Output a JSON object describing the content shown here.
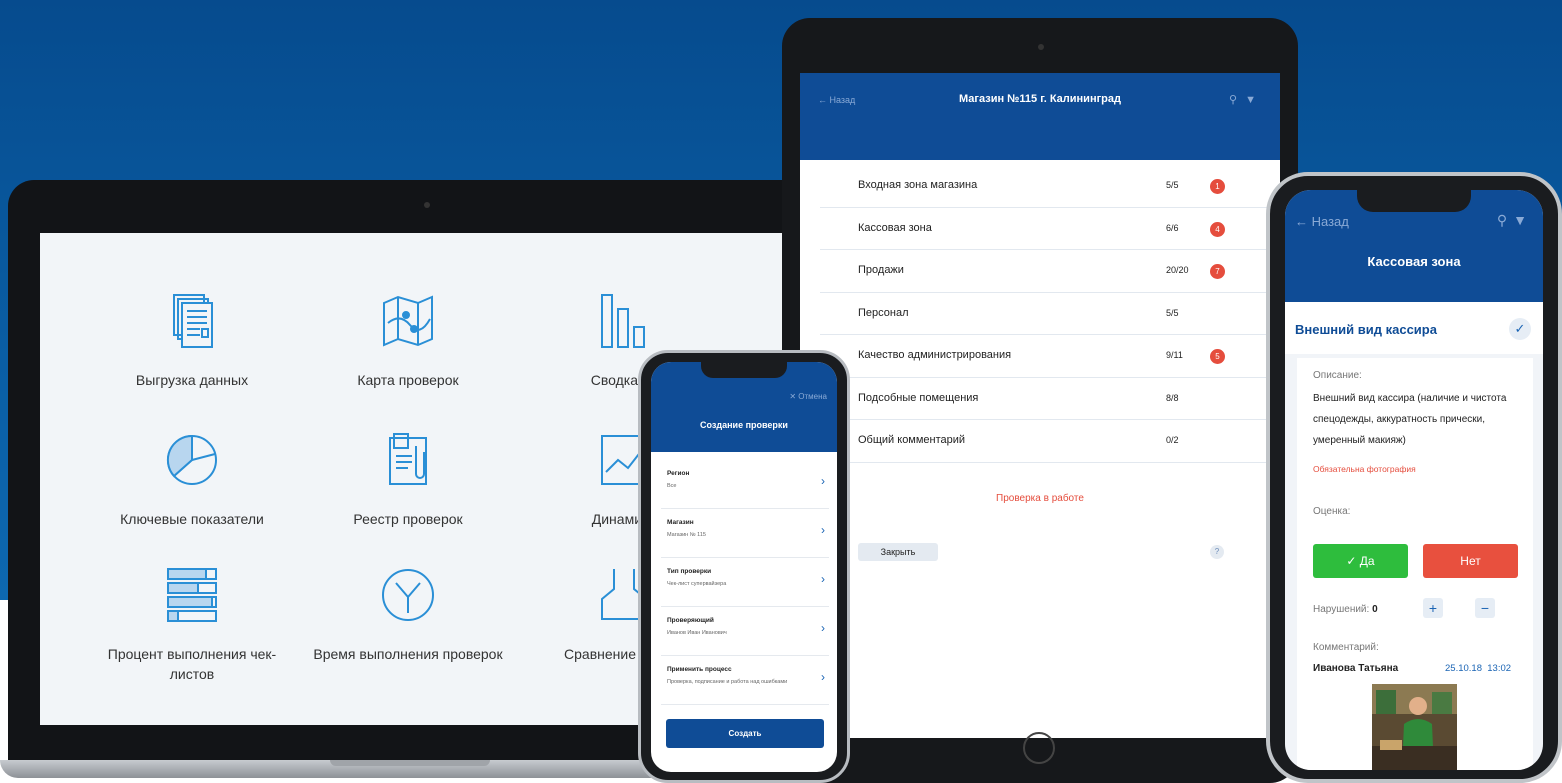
{
  "laptop": {
    "tiles": [
      {
        "label": "Выгрузка данных",
        "icon": "documents-icon"
      },
      {
        "label": "Карта проверок",
        "icon": "map-icon"
      },
      {
        "label": "Сводка по",
        "icon": "bar-chart-icon"
      },
      {
        "label": "Ключевые показатели",
        "icon": "pie-chart-icon"
      },
      {
        "label": "Реестр проверок",
        "icon": "clipboard-icon"
      },
      {
        "label": "Динамика",
        "icon": "trend-icon"
      },
      {
        "label": "Процент выполнения чек-листов",
        "icon": "progress-bars-icon"
      },
      {
        "label": "Время выполнения проверок",
        "icon": "clock-icon"
      },
      {
        "label": "Сравнение эффек",
        "icon": "compare-icon"
      }
    ]
  },
  "tablet": {
    "back": "← Назад",
    "title": "Магазин №115 г. Калининград",
    "rows": [
      {
        "name": "Входная зона магазина",
        "count": "5/5",
        "badge": "1"
      },
      {
        "name": "Кассовая зона",
        "count": "6/6",
        "badge": "4"
      },
      {
        "name": "Продажи",
        "count": "20/20",
        "badge": "7"
      },
      {
        "name": "Персонал",
        "count": "5/5",
        "badge": ""
      },
      {
        "name": "Качество администрирования",
        "count": "9/11",
        "badge": "5"
      },
      {
        "name": "Подсобные помещения",
        "count": "8/8",
        "badge": ""
      },
      {
        "name": "Общий комментарий",
        "count": "0/2",
        "badge": ""
      }
    ],
    "status": "Проверка в работе",
    "close": "Закрыть",
    "help": "?"
  },
  "phone1": {
    "cancel": "✕ Отмена",
    "title": "Создание проверки",
    "rows": [
      {
        "key": "Регион",
        "value": "Все"
      },
      {
        "key": "Магазин",
        "value": "Магазин № 115"
      },
      {
        "key": "Тип проверки",
        "value": "Чек-лист супервайзера"
      },
      {
        "key": "Проверяющий",
        "value": "Иванов Иван Иванович"
      },
      {
        "key": "Применить процесс",
        "value": "Проверка, подписание и работа над ошибками"
      }
    ],
    "create": "Создать"
  },
  "phone2": {
    "back": "← Назад",
    "title": "Кассовая зона",
    "section": "Внешний вид кассира",
    "desc_label": "Описание:",
    "desc": "Внешний вид кассира (наличие и чистота спецодежды, аккуратность прически, умеренный макияж)",
    "required": "Обязательна фотография",
    "rating_label": "Оценка:",
    "yes": "✓ Да",
    "no": "Нет",
    "violations_label": "Нарушений:",
    "violations": "0",
    "comment_label": "Комментарий:",
    "author": "Иванова Татьяна",
    "date": "25.10.18",
    "time": "13:02"
  },
  "colors": {
    "brand": "#0f4c96",
    "accent": "#1a64b4",
    "danger": "#e54d3d",
    "success": "#2ebd3d"
  }
}
